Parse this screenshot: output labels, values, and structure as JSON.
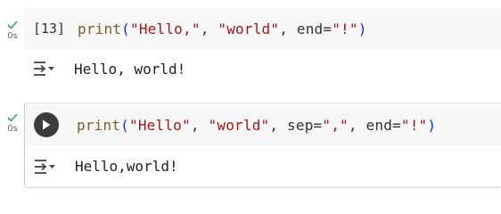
{
  "cells": [
    {
      "status_time": "0s",
      "execution_count": "[13]",
      "code_tokens": [
        "print",
        "(",
        "\"Hello,\"",
        ", ",
        "\"world\"",
        ", end=",
        "\"!\"",
        ")"
      ],
      "output": "Hello, world!"
    },
    {
      "status_time": "0s",
      "code_tokens": [
        "print",
        "(",
        "\"Hello\"",
        ", ",
        "\"world\"",
        ", sep=",
        "\",\"",
        ", end=",
        "\"!\"",
        ")"
      ],
      "output": "Hello,world!"
    }
  ],
  "colors": {
    "check": "#34a853",
    "function": "#795e26",
    "string": "#a31515",
    "paren": "#0431fa"
  },
  "icons": {
    "status": "check-icon",
    "run": "play-icon",
    "output_menu": "output-menu-icon"
  }
}
